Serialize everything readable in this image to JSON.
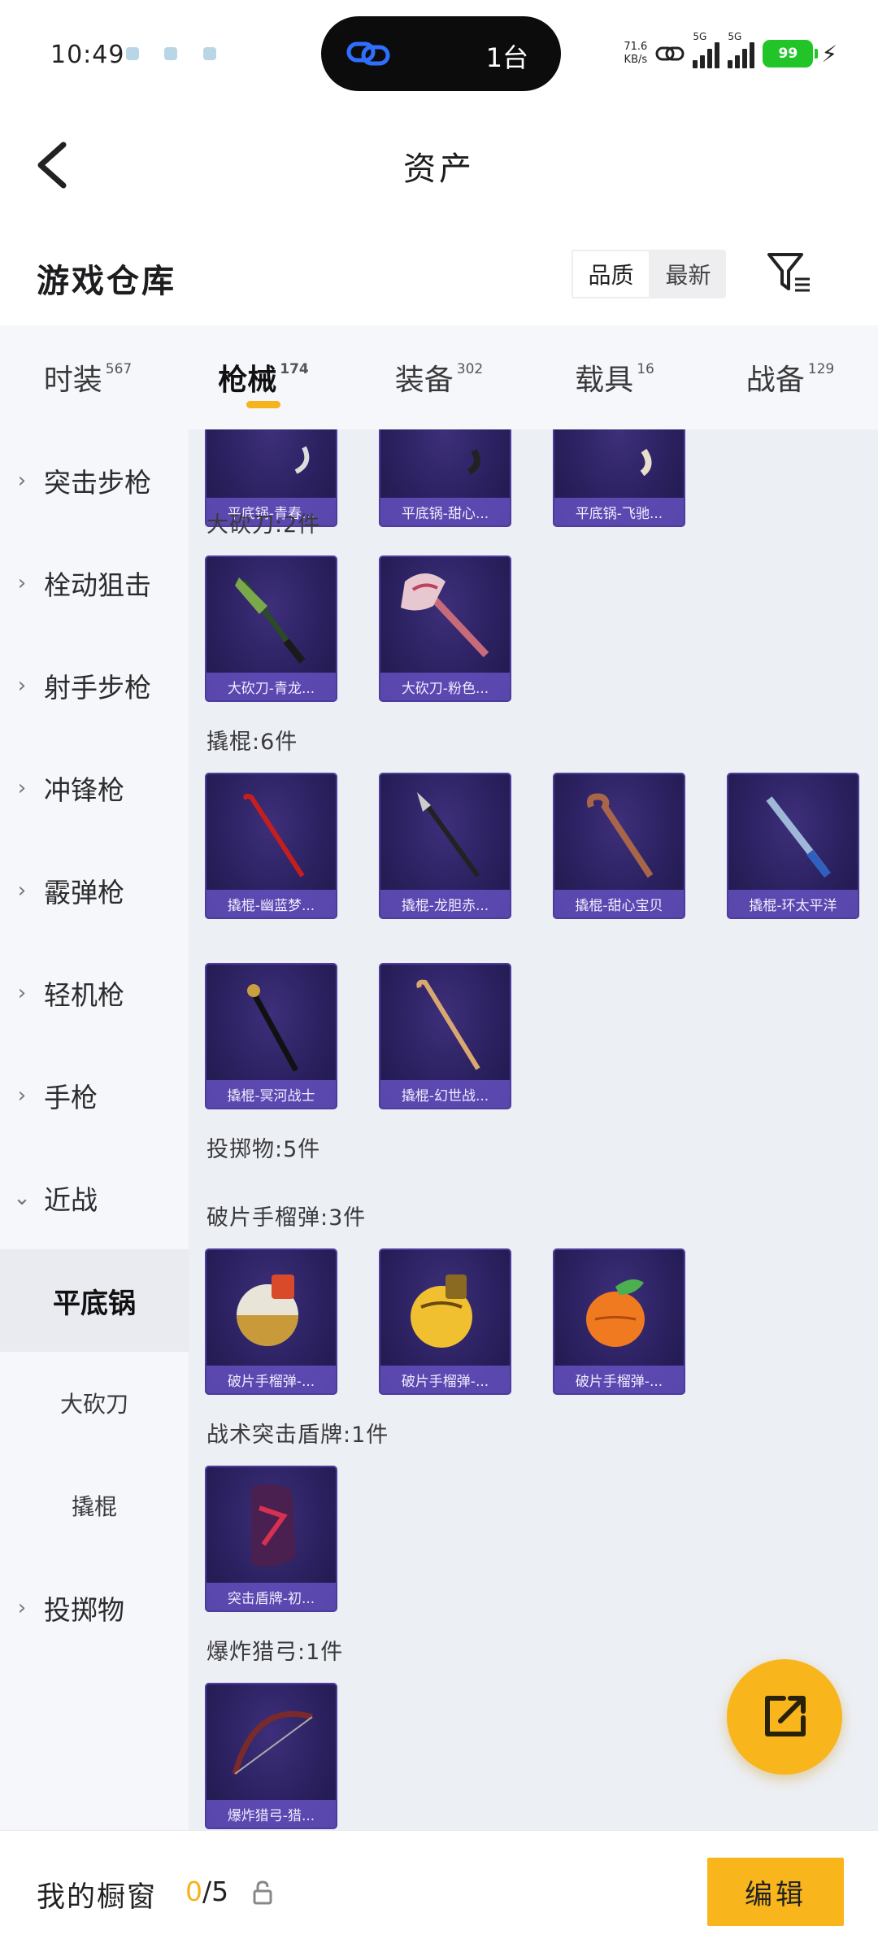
{
  "status_bar": {
    "time": "10:49",
    "pill_text": "1台",
    "net_speed_top": "71.6",
    "net_speed_bottom": "KB/s",
    "sim1": "5G",
    "sim2": "5G",
    "battery": "99"
  },
  "header": {
    "title": "资产"
  },
  "section": {
    "title": "游戏仓库",
    "sort_options": [
      "品质",
      "最新"
    ],
    "active_sort": "品质"
  },
  "tabs": [
    {
      "label": "时装",
      "count": "567"
    },
    {
      "label": "枪械",
      "count": "174"
    },
    {
      "label": "装备",
      "count": "302"
    },
    {
      "label": "载具",
      "count": "16"
    },
    {
      "label": "战备",
      "count": "129"
    }
  ],
  "active_tab": "枪械",
  "sidebar": {
    "items": [
      {
        "label": "突击步枪"
      },
      {
        "label": "栓动狙击"
      },
      {
        "label": "射手步枪"
      },
      {
        "label": "冲锋枪"
      },
      {
        "label": "霰弹枪"
      },
      {
        "label": "轻机枪"
      },
      {
        "label": "手枪"
      },
      {
        "label": "近战"
      },
      {
        "label": "平底锅"
      },
      {
        "label": "大砍刀"
      },
      {
        "label": "撬棍"
      },
      {
        "label": "投掷物"
      }
    ]
  },
  "content": {
    "partial_row": [
      "平底锅-青春...",
      "平底锅-甜心...",
      "平底锅-飞驰..."
    ],
    "groups": [
      {
        "title": "大砍刀:2件",
        "items": [
          "大砍刀-青龙...",
          "大砍刀-粉色..."
        ]
      },
      {
        "title": "撬棍:6件",
        "items": [
          "撬棍-幽蓝梦...",
          "撬棍-龙胆赤...",
          "撬棍-甜心宝贝",
          "撬棍-环太平洋",
          "撬棍-冥河战士",
          "撬棍-幻世战..."
        ]
      },
      {
        "title": "投掷物:5件",
        "items": []
      },
      {
        "title": "破片手榴弹:3件",
        "items": [
          "破片手榴弹-...",
          "破片手榴弹-...",
          "破片手榴弹-..."
        ]
      },
      {
        "title": "战术突击盾牌:1件",
        "items": [
          "突击盾牌-初..."
        ]
      },
      {
        "title": "爆炸猎弓:1件",
        "items": [
          "爆炸猎弓-猎..."
        ]
      }
    ]
  },
  "bottom_bar": {
    "label": "我的橱窗",
    "current": "0",
    "total": "/5",
    "edit_label": "编辑"
  },
  "colors": {
    "accent": "#f8b51c",
    "card_bg": "#2b2160",
    "card_label_bg": "#6a54c8",
    "content_bg": "#eceff4",
    "sidebar_bg": "#f6f7fa"
  },
  "icons": {
    "back": "chevron-left-icon",
    "filter": "filter-icon",
    "fab": "share-out-icon",
    "lock": "lock-icon"
  }
}
